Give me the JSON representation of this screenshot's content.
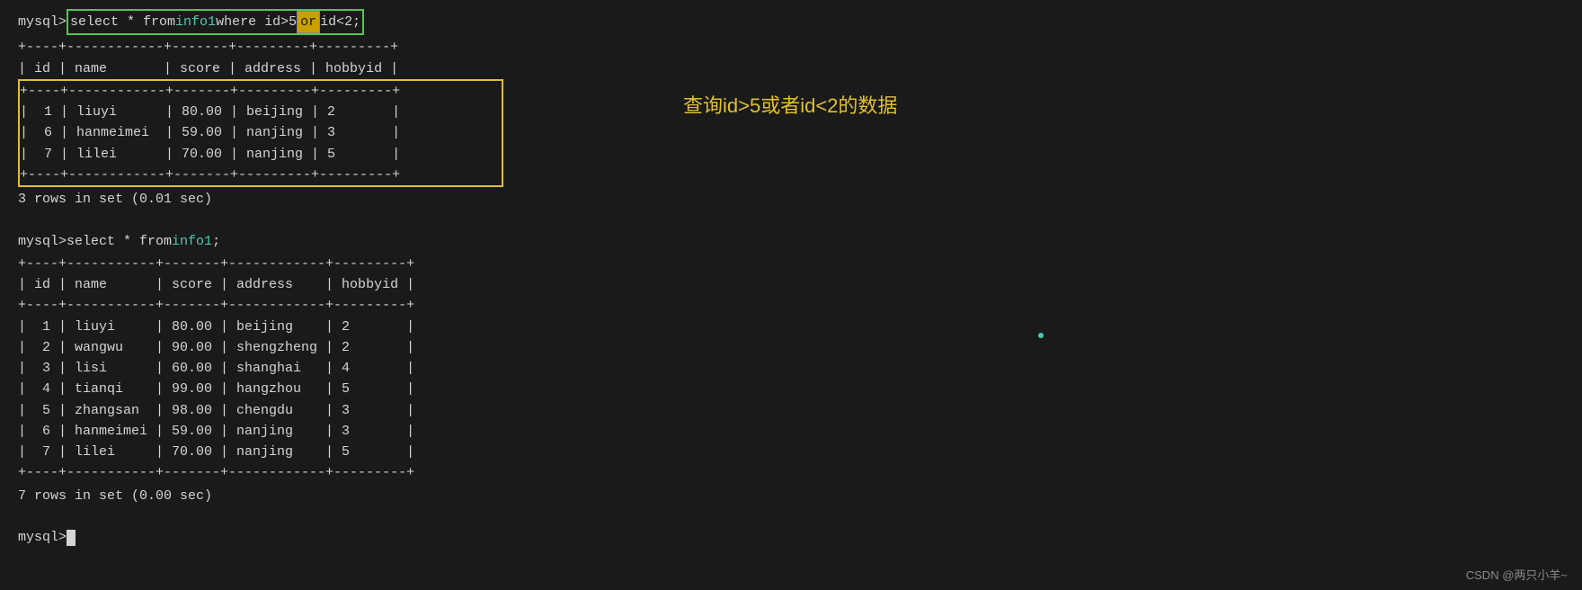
{
  "terminal": {
    "query1": {
      "prompt": "mysql> ",
      "command_before_or": "select * from ",
      "command_table": "info1",
      "command_after_table": " where id>5 ",
      "command_or": "or",
      "command_after_or": " id<2;"
    },
    "table1_separator_top": "+----+------------+-------+---------+---------+",
    "table1_header": "| id | name       | score | address | hobbyid |",
    "table1_separator_mid": "+----+------------+-------+---------+---------+",
    "table1_rows": [
      "|  1 | liuyi      | 80.00 | beijing | 2       |",
      "|  6 | hanmeimei  | 59.00 | nanjing | 3       |",
      "|  7 | lilei      | 70.00 | nanjing | 5       |"
    ],
    "table1_separator_bot": "+----+------------+-------+---------+---------+",
    "table1_count": "3 rows in set (0.01 sec)",
    "query2": {
      "prompt": "mysql> ",
      "command_before": "select * from ",
      "command_table": "info1",
      "command_after": ";"
    },
    "table2_separator_top": "+----+-----------+-------+------------+---------+",
    "table2_header": "| id | name      | score | address    | hobbyid |",
    "table2_separator_mid": "+----+-----------+-------+------------+---------+",
    "table2_rows": [
      "|  1 | liuyi     | 80.00 | beijing    | 2       |",
      "|  2 | wangwu    | 90.00 | shengzheng | 2       |",
      "|  3 | lisi      | 60.00 | shanghai   | 4       |",
      "|  4 | tianqi    | 99.00 | hangzhou   | 5       |",
      "|  5 | zhangsan  | 98.00 | chengdu    | 3       |",
      "|  6 | hanmeimei | 59.00 | nanjing    | 3       |",
      "|  7 | lilei     | 70.00 | nanjing    | 5       |"
    ],
    "table2_separator_bot": "+----+-----------+-------+------------+---------+",
    "table2_count": "7 rows in set (0.00 sec)",
    "prompt3": "mysql> "
  },
  "annotation": {
    "text": "查询id>5或者id<2的数据"
  },
  "watermark": {
    "text": "CSDN @两只小羊~"
  }
}
